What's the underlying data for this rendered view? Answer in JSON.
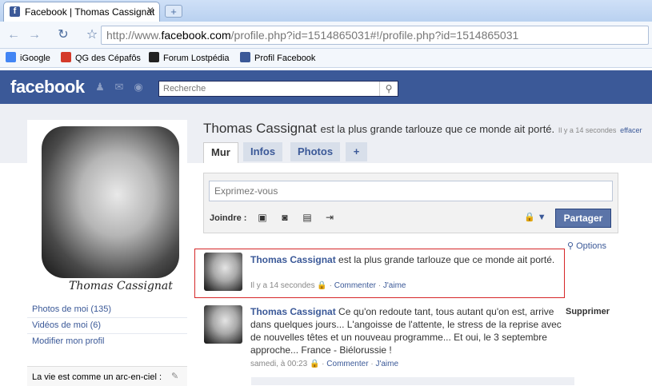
{
  "browser": {
    "tab_title": "Facebook | Thomas Cassignat",
    "tab_favicon": "f",
    "url_prefix": "http://www.",
    "url_domain": "facebook.com",
    "url_path": "/profile.php?id=1514865031#!/profile.php?id=1514865031",
    "bookmarks": [
      {
        "label": "iGoogle",
        "color": "#4285f4"
      },
      {
        "label": "QG des Cépafôs",
        "color": "#d43a2a"
      },
      {
        "label": "Forum Lostpédia",
        "color": "#222222"
      },
      {
        "label": "Profil Facebook",
        "color": "#3b5998"
      }
    ]
  },
  "fb": {
    "logo": "facebook",
    "search_placeholder": "Recherche",
    "brand_color": "#3b5998"
  },
  "profile": {
    "photo_caption": "Thomas Cassignat",
    "links": [
      "Photos de moi (135)",
      "Vidéos de moi (6)",
      "Modifier mon profil"
    ],
    "bio": "La vie est comme un arc-en-ciel :",
    "name": "Thomas Cassignat",
    "status": "est la plus grande tarlouze que ce monde ait porté.",
    "status_time": "Il y a 14 secondes",
    "erase": "effacer"
  },
  "tabs": [
    "Mur",
    "Infos",
    "Photos",
    "+"
  ],
  "composer": {
    "placeholder": "Exprimez-vous",
    "attach_label": "Joindre :",
    "share": "Partager"
  },
  "options": "Options",
  "stories": [
    {
      "author": "Thomas Cassignat",
      "text": "est la plus grande tarlouze que ce monde ait porté.",
      "time": "Il y a 14 secondes",
      "comment": "Commenter",
      "like": "J'aime"
    },
    {
      "author": "Thomas Cassignat",
      "text": "Ce qu'on redoute tant, tous autant qu'on est, arrive dans quelques jours... L'angoisse de l'attente, le stress de la reprise avec de nouvelles têtes et un nouveau programme... Et oui, le 3 septembre approche... France - Biélorussie !",
      "time": "samedi, à 00:23",
      "comment": "Commenter",
      "like": "J'aime",
      "delete": "Supprimer"
    }
  ]
}
